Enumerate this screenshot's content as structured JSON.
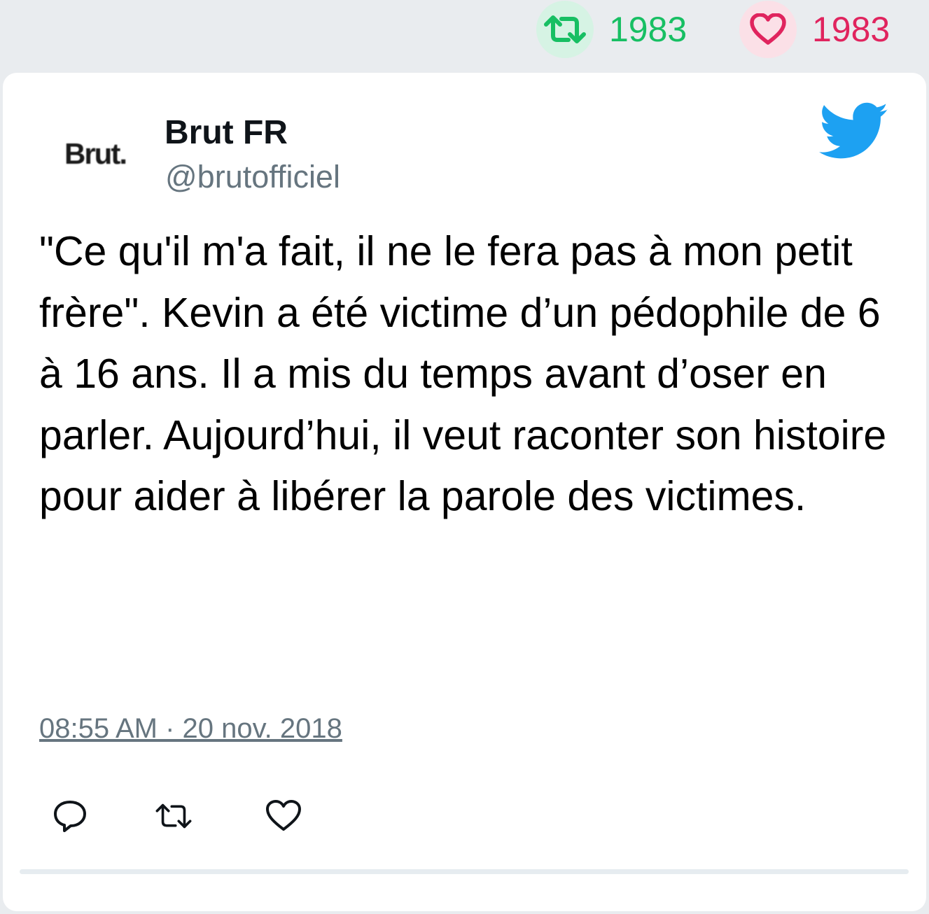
{
  "stats": {
    "retweet_count": "1983",
    "like_count": "1983"
  },
  "author": {
    "avatar_text": "Brut.",
    "name": "Brut FR",
    "handle": "@brutofficiel"
  },
  "tweet": {
    "text": "\"Ce qu'il m'a fait, il ne le fera pas à mon petit frère\". Kevin a été victime d’un pédophile de 6 à 16 ans. Il a mis du temps avant d’oser en parler. Aujourd’hui, il veut raconter son histoire pour aider à libérer la parole des victimes.",
    "timestamp": "08:55 AM · 20 nov. 2018"
  },
  "icons": {
    "retweet": "retweet-icon",
    "like": "heart-icon",
    "reply": "reply-icon",
    "logo": "twitter-bird-icon"
  },
  "colors": {
    "retweet": "#17bf63",
    "like": "#e0245e",
    "twitter_blue": "#1da1f2",
    "secondary_text": "#66757f"
  }
}
